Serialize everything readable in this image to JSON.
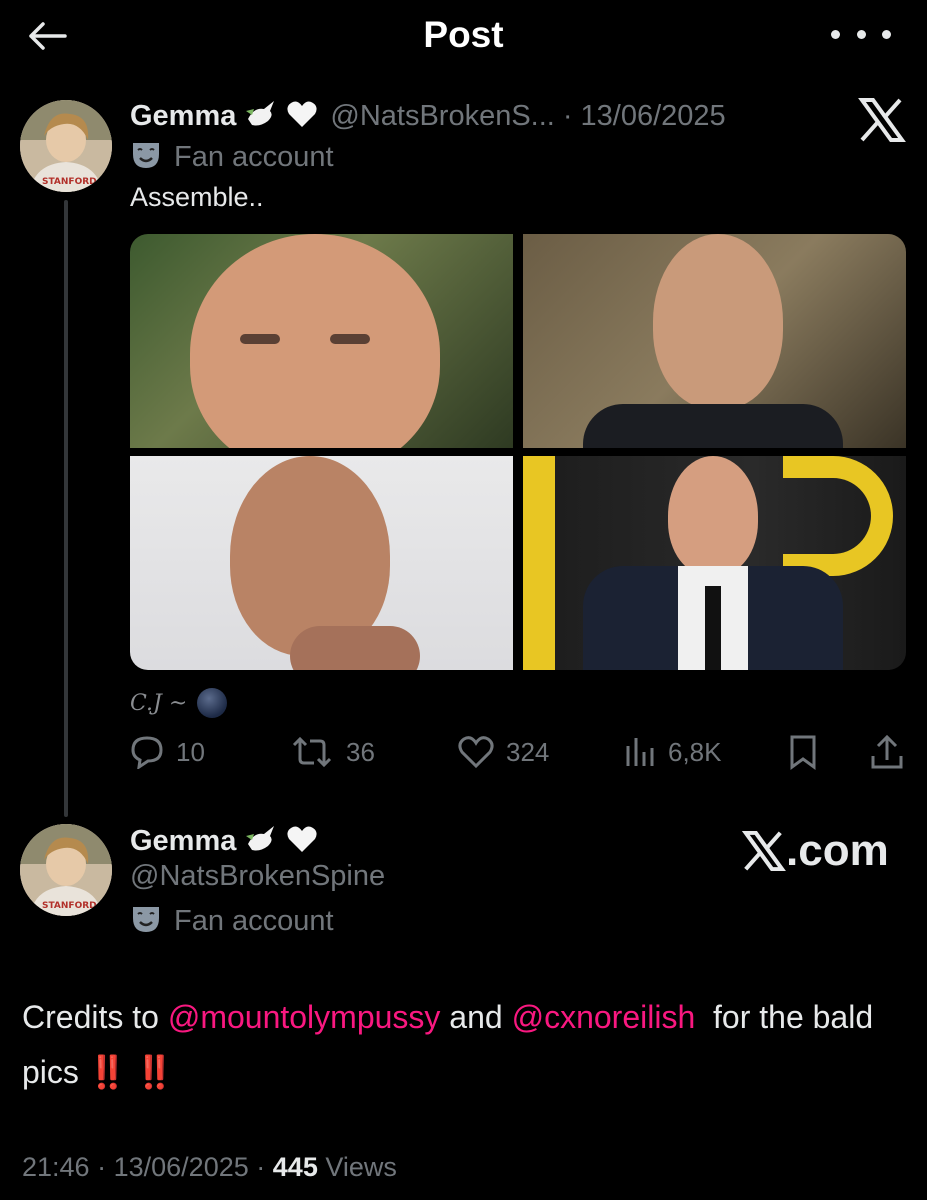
{
  "header": {
    "back_icon": "arrow-left-icon",
    "title": "Post",
    "more_icon": "more-horizontal-icon"
  },
  "quoted_post": {
    "author_name": "Gemma",
    "name_emojis": [
      "dove",
      "white-heart"
    ],
    "handle": "@NatsBrokenS...",
    "separator": "·",
    "date": "13/06/2025",
    "badge_icon": "theater-masks-icon",
    "badge_label": "Fan account",
    "text": "Assemble..",
    "source_logo": "x-logo",
    "media_count": 4,
    "media_watermark": "C.J ~",
    "stats": {
      "replies": "10",
      "reposts": "36",
      "likes": "324",
      "views": "6,8K"
    }
  },
  "reply_post": {
    "author_name": "Gemma",
    "name_emojis": [
      "dove",
      "white-heart"
    ],
    "handle": "@NatsBrokenSpine",
    "badge_icon": "theater-masks-icon",
    "badge_label": "Fan account",
    "site_label": ".com",
    "text_prefix": "Credits to ",
    "mention_1": "@mountolympussy",
    "text_middle": " and ",
    "mention_2": "@cxnoreilish",
    "text_after": "  for the bald pics ",
    "exclaim_1": "‼️",
    "exclaim_2": "‼️",
    "time": "21:46",
    "meta_separator_1": "·",
    "date": "13/06/2025",
    "meta_separator_2": "·",
    "views_count": "445",
    "views_label": "Views"
  },
  "colors": {
    "background": "#000000",
    "text": "#e7e9ea",
    "muted": "#71767b",
    "mention": "#f91880",
    "exclaim": "#e0242b"
  }
}
